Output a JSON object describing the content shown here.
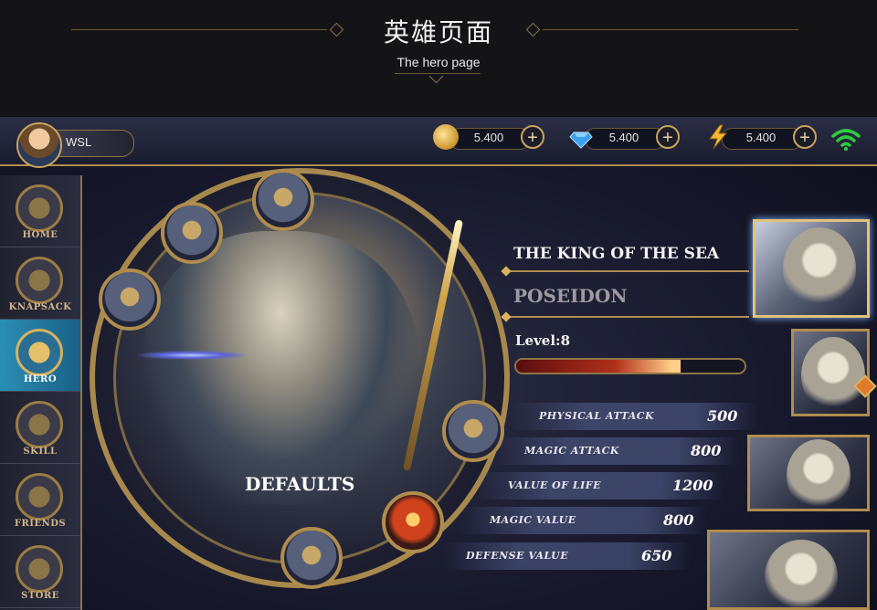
{
  "banner": {
    "title_cn": "英雄页面",
    "subtitle_en": "The hero page"
  },
  "user": {
    "name": "WSL"
  },
  "resources": [
    {
      "icon": "gold-coin-icon",
      "value": "5.400"
    },
    {
      "icon": "diamond-icon",
      "value": "5.400"
    },
    {
      "icon": "energy-bolt-icon",
      "value": "5.400"
    }
  ],
  "nav": [
    {
      "label": "HOME",
      "icon": "home-icon"
    },
    {
      "label": "KNAPSACK",
      "icon": "knapsack-icon"
    },
    {
      "label": "HERO",
      "icon": "hero-helmet-icon",
      "active": true
    },
    {
      "label": "SKILL",
      "icon": "skill-shield-icon"
    },
    {
      "label": "FRIENDS",
      "icon": "friends-handshake-icon"
    },
    {
      "label": "STORE",
      "icon": "store-icon"
    }
  ],
  "hero": {
    "skin_label": "DEFAULTS",
    "title": "THE KING OF THE SEA",
    "name": "POSEIDON",
    "level": "Level:8",
    "xp_progress": 0.72
  },
  "stats": [
    {
      "name": "PHYSICAL ATTACK",
      "value": "500"
    },
    {
      "name": "MAGIC ATTACK",
      "value": "800"
    },
    {
      "name": "VALUE OF LIFE",
      "value": "1200"
    },
    {
      "name": "MAGIC VALUE",
      "value": "800"
    },
    {
      "name": "DEFENSE VALUE",
      "value": "650"
    }
  ],
  "equipment": [
    "helmet-icon",
    "chest-armor-icon",
    "gauntlet-icon",
    "dagger-icon",
    "red-gem-icon",
    "boots-icon"
  ],
  "colors": {
    "gold": "#b08d4e",
    "active_nav": "#2a8fb3",
    "wifi": "#2ecc40"
  }
}
